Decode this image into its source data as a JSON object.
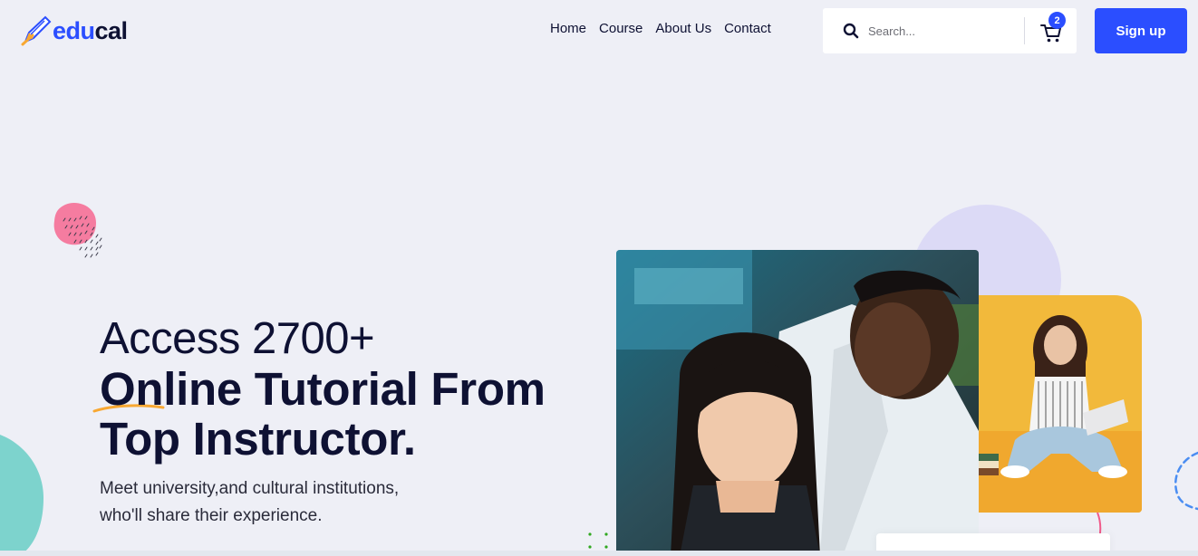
{
  "brand": {
    "name_part1": "edu",
    "name_part2": "cal"
  },
  "nav": {
    "items": [
      "Home",
      "Course",
      "About Us",
      "Contact"
    ]
  },
  "search": {
    "placeholder": "Search..."
  },
  "cart": {
    "count": "2"
  },
  "signup": {
    "label": "Sign up"
  },
  "hero": {
    "line1": "Access 2700+",
    "line2": "Online Tutorial From",
    "line3": "Top Instructor.",
    "subtitle_line1": "Meet university,and cultural institutions,",
    "subtitle_line2": "who'll share their experience."
  },
  "icons": [
    "logo-pencil-icon",
    "search-icon",
    "cart-icon"
  ],
  "colors": {
    "accent": "#2b4eff",
    "heading": "#0e1133",
    "background": "#eeeff6",
    "highlight": "#f8a832"
  }
}
